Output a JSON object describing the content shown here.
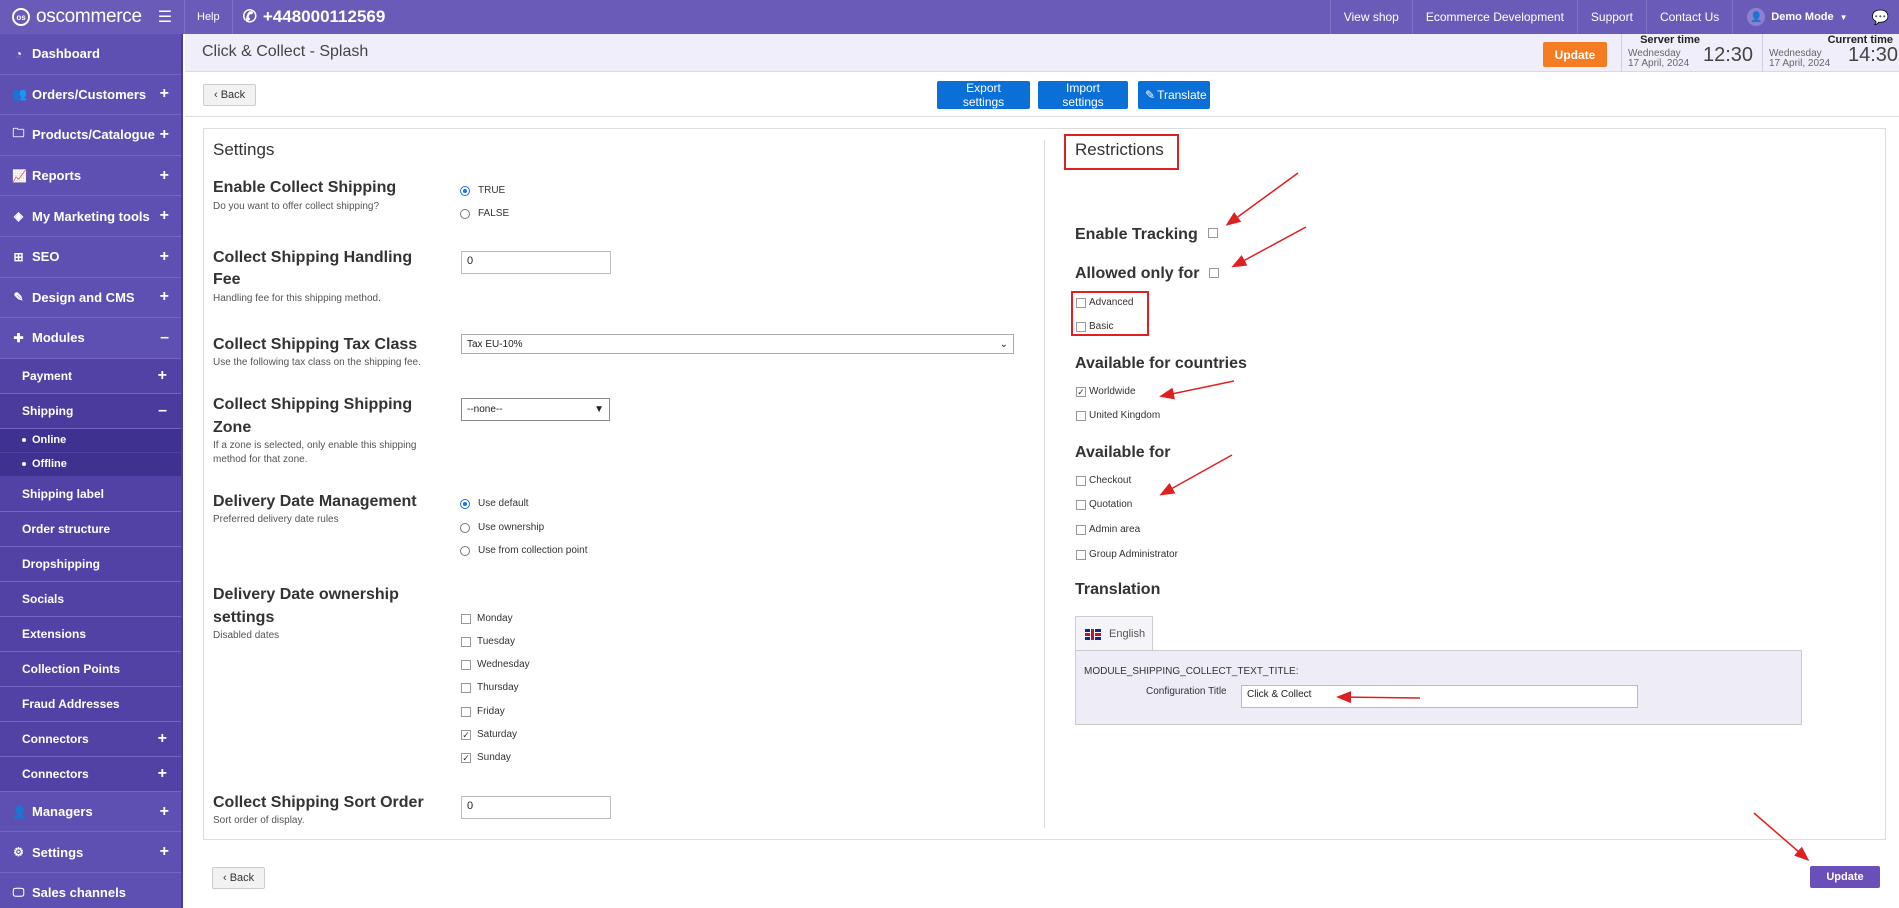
{
  "topbar": {
    "logo_badge": "os",
    "logo": "oscommerce",
    "help": "Help",
    "phone": "+448000112569",
    "links": [
      "View shop",
      "Ecommerce Development",
      "Support",
      "Contact Us"
    ],
    "user": "Demo Mode"
  },
  "sidebar": {
    "items": [
      {
        "label": "Dashboard",
        "icon": "gauge-icon",
        "pm": ""
      },
      {
        "label": "Orders/Customers",
        "icon": "users-icon",
        "pm": "+"
      },
      {
        "label": "Products/Catalogue",
        "icon": "folder-icon",
        "pm": "+"
      },
      {
        "label": "Reports",
        "icon": "chart-icon",
        "pm": "+"
      },
      {
        "label": "My Marketing tools",
        "icon": "tag-icon",
        "pm": "+"
      },
      {
        "label": "SEO",
        "icon": "sitemap-icon",
        "pm": "+"
      },
      {
        "label": "Design and CMS",
        "icon": "brush-icon",
        "pm": "+"
      },
      {
        "label": "Modules",
        "icon": "puzzle-icon",
        "pm": "–"
      }
    ],
    "modules_sub": [
      {
        "label": "Payment",
        "pm": "+"
      },
      {
        "label": "Shipping",
        "pm": "–"
      }
    ],
    "shipping_sub": [
      "Online",
      "Offline"
    ],
    "modules_sub2": [
      {
        "label": "Shipping label",
        "pm": ""
      },
      {
        "label": "Order structure",
        "pm": ""
      },
      {
        "label": "Dropshipping",
        "pm": ""
      },
      {
        "label": "Socials",
        "pm": ""
      },
      {
        "label": "Extensions",
        "pm": ""
      },
      {
        "label": "Collection Points",
        "pm": ""
      },
      {
        "label": "Fraud Addresses",
        "pm": ""
      },
      {
        "label": "Connectors",
        "pm": "+"
      },
      {
        "label": "Connectors",
        "pm": "+"
      }
    ],
    "bottom_items": [
      {
        "label": "Managers",
        "icon": "user-icon",
        "pm": "+"
      },
      {
        "label": "Settings",
        "icon": "cogs-icon",
        "pm": "+"
      },
      {
        "label": "Sales channels",
        "icon": "monitor-icon",
        "pm": ""
      }
    ]
  },
  "header": {
    "title": "Click & Collect - Splash",
    "update": "Update",
    "server_time_label": "Server time",
    "server_date_1": "Wednesday",
    "server_date_2": "17 April, 2024",
    "server_time": "12:30",
    "current_time_label": "Current time",
    "current_date_1": "Wednesday",
    "current_date_2": "17 April, 2024",
    "current_time": "14:30"
  },
  "toolbar": {
    "back": "‹ Back",
    "export": "Export settings",
    "import": "Import settings",
    "translate": "Translate"
  },
  "settings": {
    "title": "Settings",
    "enable_collect": {
      "label": "Enable Collect Shipping",
      "desc": "Do you want to offer collect shipping?",
      "options": [
        "TRUE",
        "FALSE"
      ],
      "selected": "TRUE"
    },
    "handling_fee": {
      "label_1": "Collect Shipping Handling",
      "label_2": "Fee",
      "desc": "Handling fee for this shipping method.",
      "value": "0"
    },
    "tax_class": {
      "label": "Collect Shipping Tax Class",
      "desc": "Use the following tax class on the shipping fee.",
      "value": "Tax EU-10%"
    },
    "zone": {
      "label_1": "Collect Shipping Shipping",
      "label_2": "Zone",
      "desc_1": "If a zone is selected, only enable this shipping",
      "desc_2": "method for that zone.",
      "value": "--none--"
    },
    "delivery_mgmt": {
      "label": "Delivery Date Management",
      "desc": "Preferred delivery date rules",
      "options": [
        "Use default",
        "Use ownership",
        "Use from collection point"
      ],
      "selected": "Use default"
    },
    "ownership": {
      "label_1": "Delivery Date ownership",
      "label_2": "settings",
      "desc": "Disabled dates",
      "days": [
        {
          "name": "Monday",
          "checked": false
        },
        {
          "name": "Tuesday",
          "checked": false
        },
        {
          "name": "Wednesday",
          "checked": false
        },
        {
          "name": "Thursday",
          "checked": false
        },
        {
          "name": "Friday",
          "checked": false
        },
        {
          "name": "Saturday",
          "checked": true
        },
        {
          "name": "Sunday",
          "checked": true
        }
      ]
    },
    "sort_order": {
      "label": "Collect Shipping Sort Order",
      "desc": "Sort order of display.",
      "value": "0"
    }
  },
  "restrictions": {
    "title": "Restrictions",
    "enable_tracking": "Enable Tracking",
    "allowed_only_for": "Allowed only for",
    "groups": [
      "Advanced",
      "Basic"
    ],
    "countries_title": "Available for countries",
    "countries": [
      {
        "name": "Worldwide",
        "checked": true
      },
      {
        "name": "United Kingdom",
        "checked": false
      }
    ],
    "available_title": "Available for",
    "available": [
      "Checkout",
      "Quotation",
      "Admin area",
      "Group Administrator"
    ],
    "translation_title": "Translation",
    "lang_tab": "English",
    "const_name": "MODULE_SHIPPING_COLLECT_TEXT_TITLE:",
    "config_label": "Configuration Title",
    "config_value": "Click & Collect"
  },
  "footer": {
    "back": "‹ Back",
    "update": "Update"
  },
  "colors": {
    "sidebar": "#5e4fb3",
    "topbar": "#6a5bb8",
    "accent_blue": "#0b6fd8",
    "update_orange": "#f57c22",
    "annotation_red": "#e02020"
  }
}
